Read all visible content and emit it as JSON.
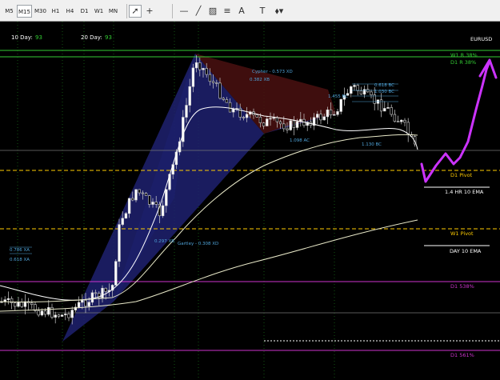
{
  "toolbar": {
    "timeframes": [
      "M5",
      "M15",
      "M30",
      "H1",
      "H4",
      "D1",
      "W1",
      "MN"
    ],
    "active_timeframe": "M15",
    "tools": [
      {
        "name": "cursor-icon",
        "glyph": "➚"
      },
      {
        "name": "crosshair-icon",
        "glyph": "+"
      },
      {
        "name": "horizontal-line-icon",
        "glyph": "—"
      },
      {
        "name": "trendline-icon",
        "glyph": "╱"
      },
      {
        "name": "channel-icon",
        "glyph": "▨"
      },
      {
        "name": "fibonacci-icon",
        "glyph": "≡"
      },
      {
        "name": "text-icon",
        "glyph": "A"
      },
      {
        "name": "label-icon",
        "glyph": "T"
      },
      {
        "name": "shapes-menu-icon",
        "glyph": "⬧▾"
      }
    ]
  },
  "chart": {
    "symbol": "EURUSD",
    "ma_10_label": "10 Day:",
    "ma_10_value": "93",
    "ma_20_label": "20 Day:",
    "ma_20_value": "93",
    "levels": [
      {
        "text": "W1 R 38%",
        "color": "#33cc33"
      },
      {
        "text": "D1 R 38%",
        "color": "#33cc33"
      },
      {
        "text": "D1 Pivot",
        "color": "#ffcc00"
      },
      {
        "text": "1.4 HR 10 EMA",
        "color": "#ffffff"
      },
      {
        "text": "W1 Pivot",
        "color": "#ffcc00"
      },
      {
        "text": "DAY 10 EMA",
        "color": "#ffffff"
      },
      {
        "text": "D1 538%",
        "color": "#cc33cc"
      },
      {
        "text": "D1 561%",
        "color": "#cc33cc"
      }
    ],
    "pattern_labels": [
      "Cypher - 0.573 XD",
      "0.382 XB",
      "1.455 BC",
      "0.618 BC",
      "1.030 BC",
      "1.098 AC",
      "1.130 BC",
      "0.297 XB",
      "Gartley - 0.308 XD",
      "0.618 XA",
      "0.786 XA"
    ],
    "colors": {
      "background": "#000000",
      "bull_candle": "#ffffff",
      "bear_candle": "#000000",
      "pattern_blue": "#2a2e8f",
      "pattern_red": "#5a1616",
      "level_green": "#33cc33",
      "pivot_yellow": "#ffcc00",
      "fib_magenta": "#cc33cc",
      "annotation_purple": "#cc33ff"
    }
  }
}
